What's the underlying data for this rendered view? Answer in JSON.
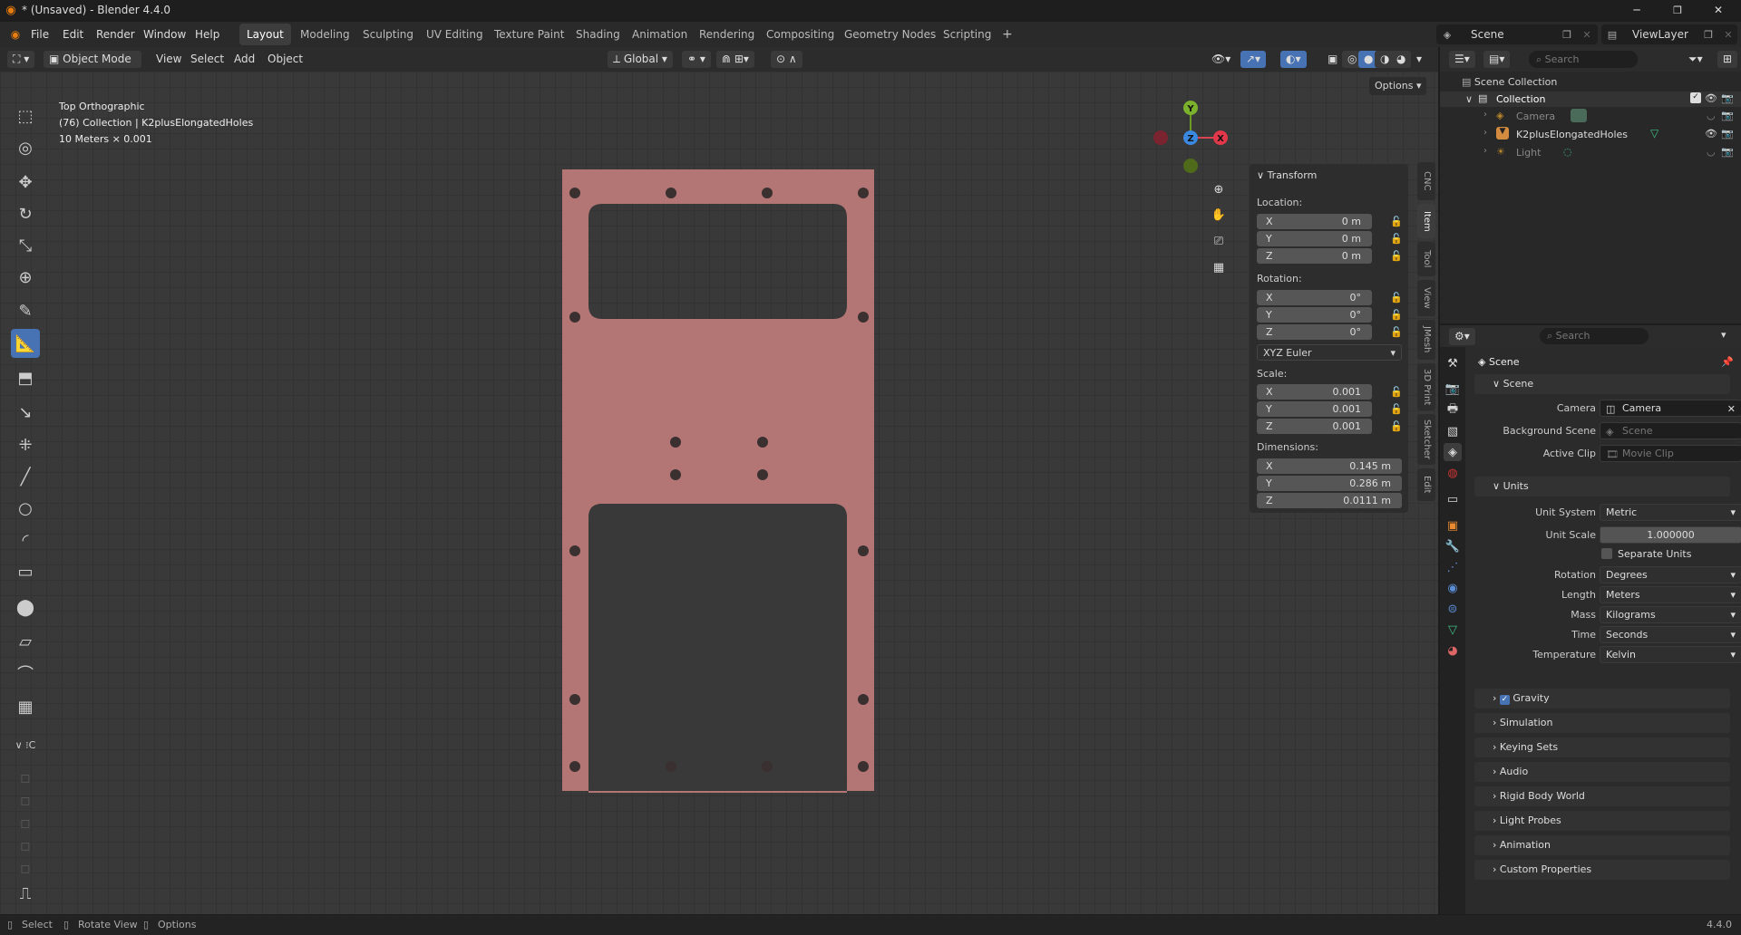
{
  "window": {
    "title": "* (Unsaved) - Blender 4.4.0"
  },
  "menu": [
    "File",
    "Edit",
    "Render",
    "Window",
    "Help"
  ],
  "workspaces": [
    "Layout",
    "Modeling",
    "Sculpting",
    "UV Editing",
    "Texture Paint",
    "Shading",
    "Animation",
    "Rendering",
    "Compositing",
    "Geometry Nodes",
    "Scripting"
  ],
  "active_workspace": "Layout",
  "scene_field": "Scene",
  "viewlayer_field": "ViewLayer",
  "viewport_header": {
    "mode": "Object Mode",
    "menus": [
      "View",
      "Select",
      "Add",
      "Object"
    ],
    "orientation": "Global",
    "options": "Options"
  },
  "overlay": {
    "view_name": "Top Orthographic",
    "collection": "(76) Collection | K2plusElongatedHoles",
    "scale": "10 Meters × 0.001"
  },
  "npanel": {
    "title": "Transform",
    "location_label": "Location:",
    "location": {
      "x": "0 m",
      "y": "0 m",
      "z": "0 m"
    },
    "rotation_label": "Rotation:",
    "rotation": {
      "x": "0°",
      "y": "0°",
      "z": "0°"
    },
    "rotation_mode": "XYZ Euler",
    "scale_label": "Scale:",
    "scale": {
      "x": "0.001",
      "y": "0.001",
      "z": "0.001"
    },
    "dimensions_label": "Dimensions:",
    "dimensions": {
      "x": "0.145 m",
      "y": "0.286 m",
      "z": "0.0111 m"
    },
    "axis": {
      "x": "X",
      "y": "Y",
      "z": "Z"
    },
    "side_tabs": [
      "CNC",
      "Item",
      "Tool",
      "View",
      "JMesh",
      "3D Print",
      "Sketcher",
      "Edit"
    ]
  },
  "gizmo": {
    "x": "X",
    "y": "Y",
    "z": "Z"
  },
  "outliner": {
    "search_placeholder": "Search",
    "root": "Scene Collection",
    "collection": "Collection",
    "items": [
      "Camera",
      "K2plusElongatedHoles",
      "Light"
    ]
  },
  "properties": {
    "search_placeholder": "Search",
    "context": "Scene",
    "scene_section": "Scene",
    "camera_label": "Camera",
    "camera_value": "Camera",
    "bg_scene_label": "Background Scene",
    "bg_scene_placeholder": "Scene",
    "active_clip_label": "Active Clip",
    "active_clip_placeholder": "Movie Clip",
    "units_section": "Units",
    "unit_system_label": "Unit System",
    "unit_system": "Metric",
    "unit_scale_label": "Unit Scale",
    "unit_scale": "1.000000",
    "separate_units": "Separate Units",
    "rotation_label": "Rotation",
    "rotation": "Degrees",
    "length_label": "Length",
    "length": "Meters",
    "mass_label": "Mass",
    "mass": "Kilograms",
    "time_label": "Time",
    "time": "Seconds",
    "temperature_label": "Temperature",
    "temperature": "Kelvin",
    "collapsed": [
      "Gravity",
      "Simulation",
      "Keying Sets",
      "Audio",
      "Rigid Body World",
      "Light Probes",
      "Animation",
      "Custom Properties"
    ]
  },
  "statusbar": {
    "select": "Select",
    "rotate": "Rotate View",
    "options": "Options",
    "version": "4.4.0"
  },
  "colors": {
    "plate": "#b47575",
    "accent": "#4772b3",
    "grid_bg": "#393939"
  }
}
